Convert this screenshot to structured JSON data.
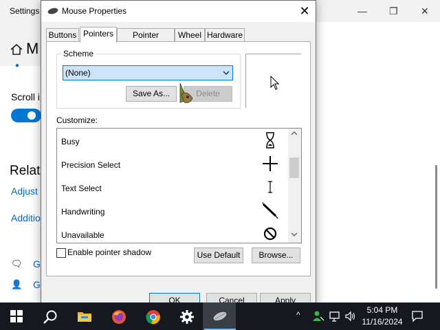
{
  "settings": {
    "title": "Settings",
    "header_letter": "M",
    "scroll_label": "Scroll i",
    "related_heading": "Relate",
    "link_adjust": "Adjust",
    "link_additional": "Additio",
    "row1_link": "Ge",
    "row2_link": "Gi"
  },
  "dialog": {
    "title": "Mouse Properties",
    "close_label": "✕",
    "tabs": [
      {
        "label": "Buttons"
      },
      {
        "label": "Pointers"
      },
      {
        "label": "Pointer Options"
      },
      {
        "label": "Wheel"
      },
      {
        "label": "Hardware"
      }
    ],
    "active_tab": "Pointers",
    "scheme": {
      "legend": "Scheme",
      "selected": "(None)",
      "save_as_label": "Save As...",
      "delete_label": "Delete"
    },
    "customize_label": "Customize:",
    "cursor_rows": [
      {
        "label": "Busy",
        "icon": "hourglass-icon"
      },
      {
        "label": "Precision Select",
        "icon": "crosshair-icon"
      },
      {
        "label": "Text Select",
        "icon": "ibeam-icon"
      },
      {
        "label": "Handwriting",
        "icon": "pen-icon"
      },
      {
        "label": "Unavailable",
        "icon": "unavailable-icon"
      }
    ],
    "shadow_label": "Enable pointer shadow",
    "use_default_label": "Use Default",
    "browse_label": "Browse...",
    "ok_label": "OK",
    "cancel_label": "Cancel",
    "apply_label": "Apply"
  },
  "taskbar": {
    "items": [
      {
        "name": "start-icon"
      },
      {
        "name": "search-icon"
      },
      {
        "name": "file-explorer-icon"
      },
      {
        "name": "firefox-icon"
      },
      {
        "name": "chrome-icon"
      },
      {
        "name": "settings-gear-icon"
      },
      {
        "name": "mouse-properties-icon"
      }
    ],
    "tray_chevron": "^",
    "time": "5:04 PM",
    "date": "11/16/2024"
  },
  "colors": {
    "accent": "#0078d7",
    "settings_link": "#0067c0",
    "taskbar_bg": "#15191f"
  }
}
